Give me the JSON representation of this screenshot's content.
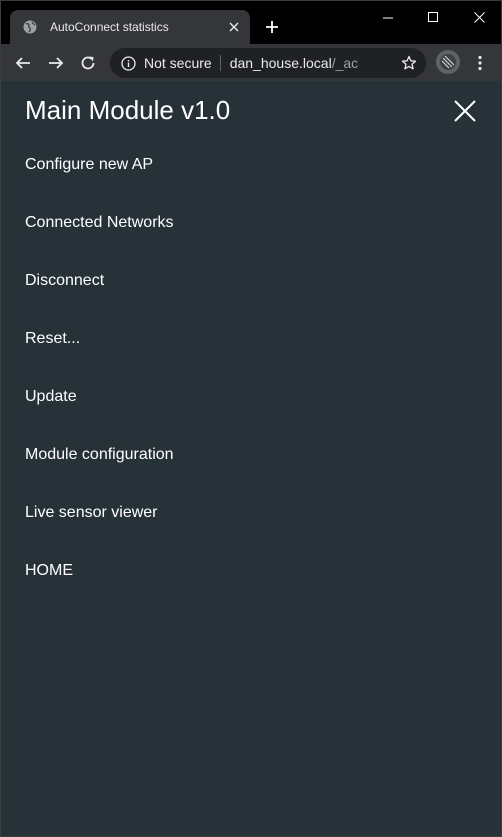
{
  "browser": {
    "tab_title": "AutoConnect statistics",
    "security_label": "Not secure",
    "url_host": "dan_house.local",
    "url_path": "/_ac"
  },
  "page": {
    "title": "Main Module v1.0",
    "menu": [
      {
        "label": "Configure new AP"
      },
      {
        "label": "Connected Networks"
      },
      {
        "label": "Disconnect"
      },
      {
        "label": "Reset..."
      },
      {
        "label": "Update"
      },
      {
        "label": "Module configuration"
      },
      {
        "label": "Live sensor viewer"
      },
      {
        "label": "HOME"
      }
    ]
  },
  "colors": {
    "page_background": "#263238",
    "text": "#ffffff",
    "chrome_dark": "#000000",
    "toolbar": "#35363a"
  }
}
